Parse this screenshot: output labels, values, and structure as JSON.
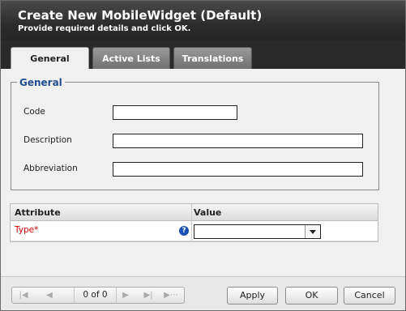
{
  "dialog": {
    "title": "Create New MobileWidget (Default)",
    "subtitle": "Provide required details and click OK."
  },
  "tabs": [
    {
      "label": "General",
      "active": true
    },
    {
      "label": "Active Lists",
      "active": false
    },
    {
      "label": "Translations",
      "active": false
    }
  ],
  "general": {
    "legend": "General",
    "fields": [
      {
        "label": "Code",
        "value": ""
      },
      {
        "label": "Description",
        "value": ""
      },
      {
        "label": "Abbreviation",
        "value": ""
      }
    ]
  },
  "attributes": {
    "headers": [
      "Attribute",
      "Value"
    ],
    "rows": [
      {
        "name": "Type*",
        "required": true,
        "value": ""
      }
    ]
  },
  "pager": {
    "info": "0 of 0"
  },
  "buttons": {
    "apply": "Apply",
    "ok": "OK",
    "cancel": "Cancel"
  },
  "colors": {
    "titlebar": "#2c2c2c",
    "legend": "#1f4e8f",
    "required": "#cc0000",
    "help_icon": "#1b4fb8"
  },
  "icons": {
    "help": "?",
    "pager_first": "first-page-icon",
    "pager_prev": "prev-page-icon",
    "pager_next": "next-page-icon",
    "pager_last": "last-page-icon",
    "pager_refresh": "refresh-icon"
  }
}
